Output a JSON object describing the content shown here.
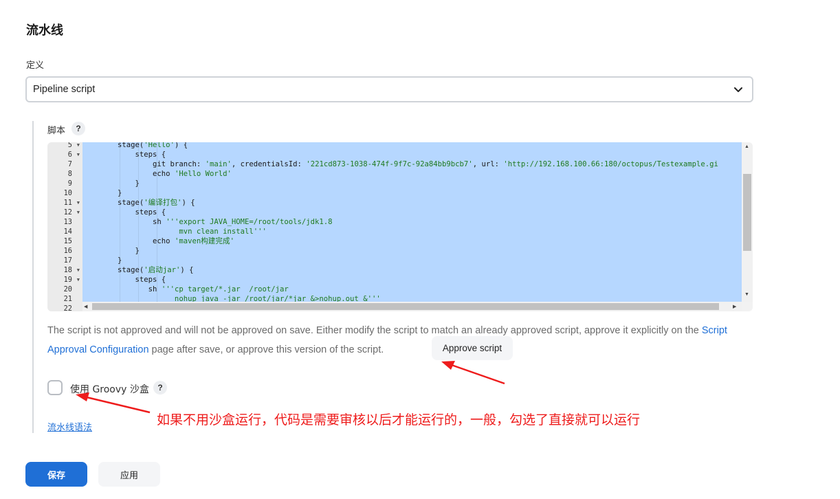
{
  "section_title": "流水线",
  "definition": {
    "label": "定义",
    "selected": "Pipeline script"
  },
  "script": {
    "label": "脚本",
    "help": "?",
    "gutter": [
      {
        "n": "5",
        "fold": true
      },
      {
        "n": "6",
        "fold": true
      },
      {
        "n": "7",
        "fold": false
      },
      {
        "n": "8",
        "fold": false
      },
      {
        "n": "9",
        "fold": false
      },
      {
        "n": "10",
        "fold": false
      },
      {
        "n": "11",
        "fold": true
      },
      {
        "n": "12",
        "fold": true
      },
      {
        "n": "13",
        "fold": false
      },
      {
        "n": "14",
        "fold": false
      },
      {
        "n": "15",
        "fold": false
      },
      {
        "n": "16",
        "fold": false
      },
      {
        "n": "17",
        "fold": false
      },
      {
        "n": "18",
        "fold": true
      },
      {
        "n": "19",
        "fold": true
      },
      {
        "n": "20",
        "fold": false
      },
      {
        "n": "21",
        "fold": false
      },
      {
        "n": "22",
        "fold": false
      }
    ],
    "lines": [
      [
        {
          "t": "        stage("
        },
        {
          "t": "'Hello'",
          "s": 1
        },
        {
          "t": ") {"
        }
      ],
      [
        {
          "t": "            steps {"
        }
      ],
      [
        {
          "t": "                git branch: "
        },
        {
          "t": "'main'",
          "s": 1
        },
        {
          "t": ", credentialsId: "
        },
        {
          "t": "'221cd873-1038-474f-9f7c-92a84bb9bcb7'",
          "s": 1
        },
        {
          "t": ", url: "
        },
        {
          "t": "'http://192.168.100.66:180/octopus/Testexample.gi",
          "s": 1
        }
      ],
      [
        {
          "t": "                echo "
        },
        {
          "t": "'Hello World'",
          "s": 1
        }
      ],
      [
        {
          "t": "            }"
        }
      ],
      [
        {
          "t": "        }"
        }
      ],
      [
        {
          "t": "        stage("
        },
        {
          "t": "'编译打包'",
          "s": 1
        },
        {
          "t": ") {"
        }
      ],
      [
        {
          "t": "            steps {"
        }
      ],
      [
        {
          "t": "                sh "
        },
        {
          "t": "'''export JAVA_HOME=/root/tools/jdk1.8",
          "s": 1
        }
      ],
      [
        {
          "t": "                      mvn clean install'''",
          "s": 1
        }
      ],
      [
        {
          "t": "                echo "
        },
        {
          "t": "'maven构建完成'",
          "s": 1
        }
      ],
      [
        {
          "t": "            }"
        }
      ],
      [
        {
          "t": "        }"
        }
      ],
      [
        {
          "t": "        stage("
        },
        {
          "t": "'启动jar'",
          "s": 1
        },
        {
          "t": ") {"
        }
      ],
      [
        {
          "t": "            steps {"
        }
      ],
      [
        {
          "t": "               sh "
        },
        {
          "t": "'''cp target/*.jar  /root/jar",
          "s": 1
        }
      ],
      [
        {
          "t": "                     nohup java -jar /root/jar/*jar &>nohup.out &'''",
          "s": 1
        }
      ],
      [
        {
          "t": ""
        }
      ]
    ]
  },
  "approval": {
    "text_before": "The script is not approved and will not be approved on save. Either modify the script to match an already approved script, approve it explicitly on the ",
    "link": "Script Approval Configuration",
    "text_after": " page after save, or approve this version of the script.",
    "button": "Approve script"
  },
  "sandbox": {
    "label": "使用 Groovy 沙盒",
    "help": "?",
    "checked": false
  },
  "syntax_link": "流水线语法",
  "annotation": "如果不用沙盒运行，代码是需要审核以后才能运行的，一般，勾选了直接就可以运行",
  "buttons": {
    "save": "保存",
    "apply": "应用"
  },
  "colors": {
    "accent": "#1f6fd6",
    "annotation": "#ee1c1c",
    "selection": "#b6d7ff"
  }
}
